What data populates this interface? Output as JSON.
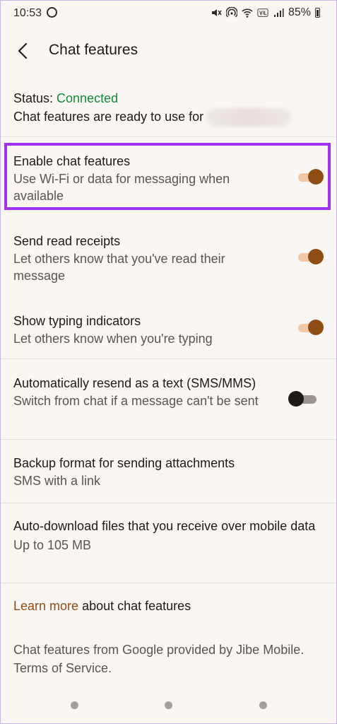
{
  "status_bar": {
    "time": "10:53",
    "battery": "85%",
    "icons": [
      "whatsapp-icon",
      "mute-icon",
      "hotspot-icon",
      "wifi-icon",
      "volte-icon",
      "signal-icon",
      "battery-icon"
    ]
  },
  "app_bar": {
    "back_icon": "back-arrow-icon",
    "title": "Chat features"
  },
  "status": {
    "label": "Status: ",
    "value": "Connected",
    "desc": "Chat features are ready to use for"
  },
  "settings": [
    {
      "title": "Enable chat features",
      "subtitle": "Use Wi-Fi or data for messaging when available",
      "toggle": true
    },
    {
      "title": "Send read receipts",
      "subtitle": "Let others know that you've read their message",
      "toggle": true
    },
    {
      "title": "Show typing indicators",
      "subtitle": "Let others know when you're typing",
      "toggle": true
    },
    {
      "title": "Automatically resend as a text (SMS/MMS)",
      "subtitle": "Switch from chat if a message can't be sent",
      "toggle": false
    },
    {
      "title": "Backup format for sending attachments",
      "subtitle": "SMS with a link"
    },
    {
      "title": "Auto-download files that you receive over mobile data",
      "subtitle": "Up to 105 MB"
    }
  ],
  "learn_more": {
    "link": "Learn more",
    "rest": " about chat features"
  },
  "footer": {
    "line1": "Chat features from Google provided by Jibe Mobile.",
    "line2": "Terms of Service."
  },
  "colors": {
    "accent": "#8f4d16",
    "connected": "#148a3a",
    "highlight": "#a133f0"
  }
}
